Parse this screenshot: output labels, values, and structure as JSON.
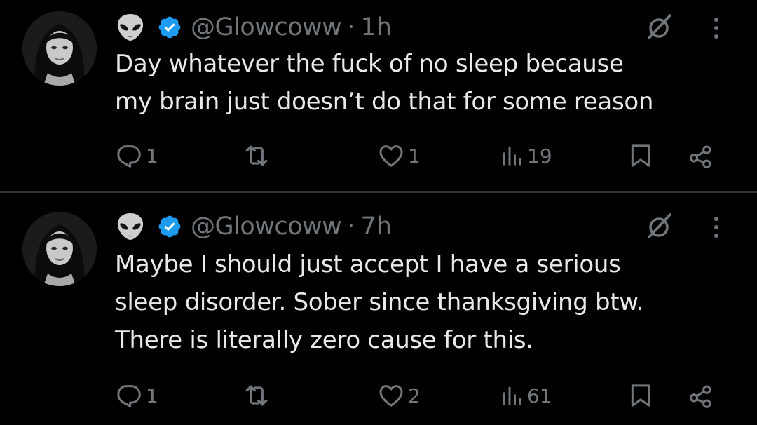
{
  "colors": {
    "background": "#000000",
    "text_primary": "#e7e9ea",
    "text_secondary": "#71767b",
    "verified": "#1d9bf0",
    "divider": "#2f3336"
  },
  "tweets": [
    {
      "handle": "@Glowcoww",
      "separator": "·",
      "time": "1h",
      "emoji_icon": "alien-icon",
      "lines": [
        "Day whatever the fuck of no sleep because",
        "my brain just doesn’t do that for some reason"
      ],
      "replies": "1",
      "retweets": "",
      "likes": "1",
      "views": "19"
    },
    {
      "handle": "@Glowcoww",
      "separator": "·",
      "time": "7h",
      "emoji_icon": "alien-icon",
      "lines": [
        "Maybe I should just accept I have a serious",
        "sleep disorder. Sober since thanksgiving btw.",
        "There is literally zero cause for this."
      ],
      "replies": "1",
      "retweets": "",
      "likes": "2",
      "views": "61"
    }
  ]
}
